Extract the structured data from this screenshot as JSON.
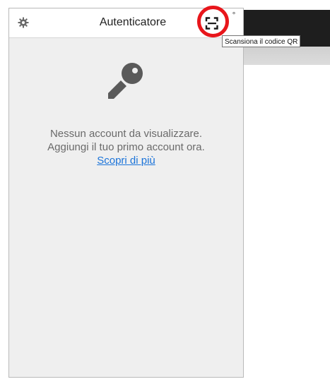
{
  "header": {
    "title": "Autenticatore",
    "more_menu": "˚"
  },
  "empty_state": {
    "line1": "Nessun account da visualizzare.",
    "line2": "Aggiungi il tuo primo account ora.",
    "learn_more": "Scopri di più"
  },
  "tooltip": {
    "text": "Scansiona il codice QR"
  },
  "icons": {
    "settings": "gear-icon",
    "scan": "qr-scan-icon",
    "empty": "key-icon"
  },
  "colors": {
    "highlight": "#e8161b",
    "link": "#1a73d9",
    "panel_bg": "#efefef"
  }
}
